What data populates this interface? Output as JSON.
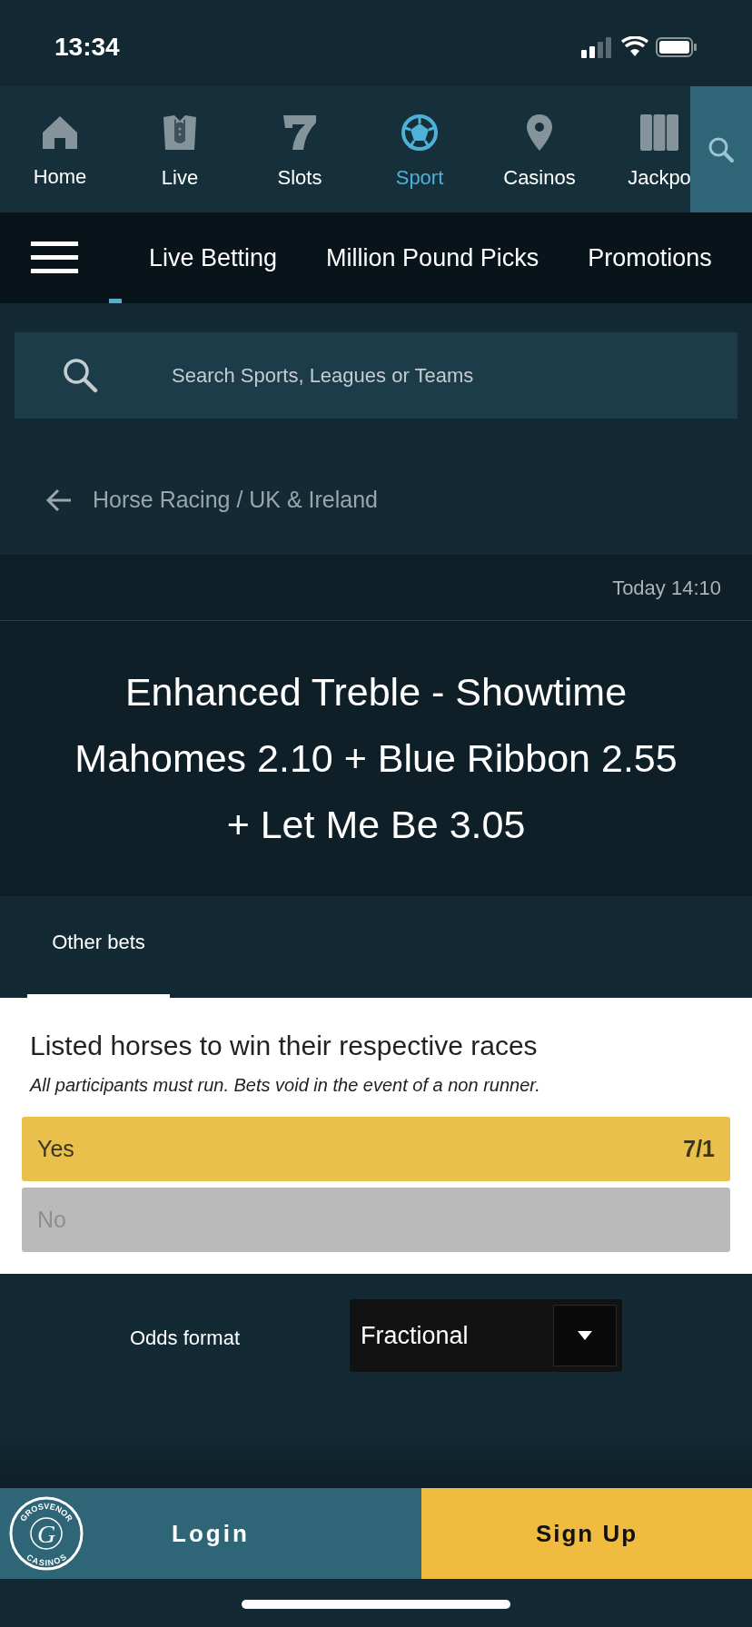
{
  "status_bar": {
    "time": "13:34"
  },
  "top_nav": [
    {
      "label": "Home",
      "selected": false
    },
    {
      "label": "Live",
      "selected": false
    },
    {
      "label": "Slots",
      "selected": false
    },
    {
      "label": "Sport",
      "selected": true
    },
    {
      "label": "Casinos",
      "selected": false
    },
    {
      "label": "Jackpo",
      "selected": false
    }
  ],
  "sub_nav": [
    {
      "label": "Live Betting",
      "selected": true
    },
    {
      "label": "Million Pound Picks",
      "selected": false
    },
    {
      "label": "Promotions",
      "selected": false
    }
  ],
  "search": {
    "placeholder": "Search Sports, Leagues or Teams"
  },
  "breadcrumb": "Horse Racing / UK & Ireland",
  "event": {
    "time": "Today 14:10",
    "title": "Enhanced Treble - Showtime Mahomes 2.10 + Blue Ribbon 2.55 + Let Me Be 3.05"
  },
  "tabs": [
    {
      "label": "Other bets",
      "selected": true
    }
  ],
  "market": {
    "title": "Listed horses to win their respective races",
    "note": "All participants must run. Bets void in the event of a non runner.",
    "options": [
      {
        "label": "Yes",
        "odds": "7/1",
        "disabled": false
      },
      {
        "label": "No",
        "disabled": true
      }
    ]
  },
  "odds_format": {
    "label": "Odds format",
    "value": "Fractional"
  },
  "footer": {
    "logo": {
      "top": "GROSVENOR",
      "bottom": "CASINOS",
      "letter": "G"
    },
    "login": "Login",
    "signup": "Sign Up"
  }
}
